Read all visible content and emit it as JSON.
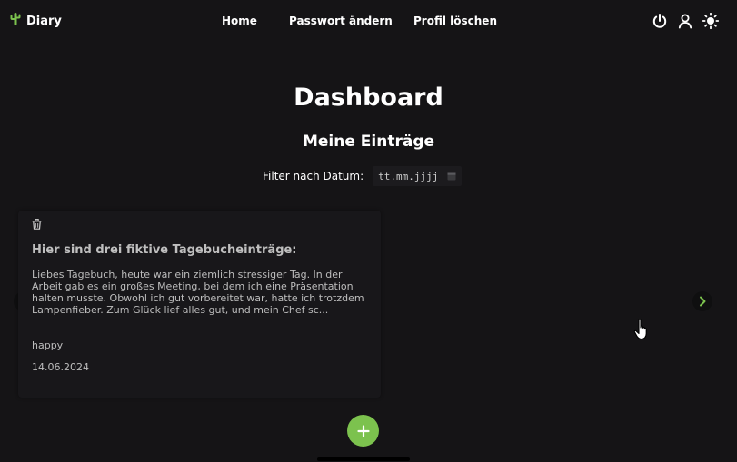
{
  "navbar": {
    "brand": {
      "icon": "cactus-icon",
      "label": "Diary"
    },
    "links": [
      {
        "label": "Home"
      },
      {
        "label": "Passwort ändern"
      },
      {
        "label": "Profil löschen"
      }
    ],
    "icons": [
      "power-icon",
      "user-icon",
      "sun-icon"
    ]
  },
  "page": {
    "title": "Dashboard",
    "section_title": "Meine Einträge"
  },
  "filter": {
    "label": "Filter nach Datum:",
    "placeholder": "tt.mm.jjjj"
  },
  "entry": {
    "title": "Hier sind drei fiktive Tagebucheinträge:",
    "body": "Liebes Tagebuch, heute war ein ziemlich stressiger Tag. In der Arbeit gab es ein großes Meeting, bei dem ich eine Präsentation halten musste. Obwohl ich gut vorbereitet war, hatte ich trotzdem Lampenfieber. Zum Glück lief alles gut, und mein Chef sc...",
    "mood": "happy",
    "date": "14.06.2024"
  },
  "colors": {
    "background": "#151416",
    "card": "#18171a",
    "accent": "#7cc24e",
    "text": "#ffffff"
  }
}
